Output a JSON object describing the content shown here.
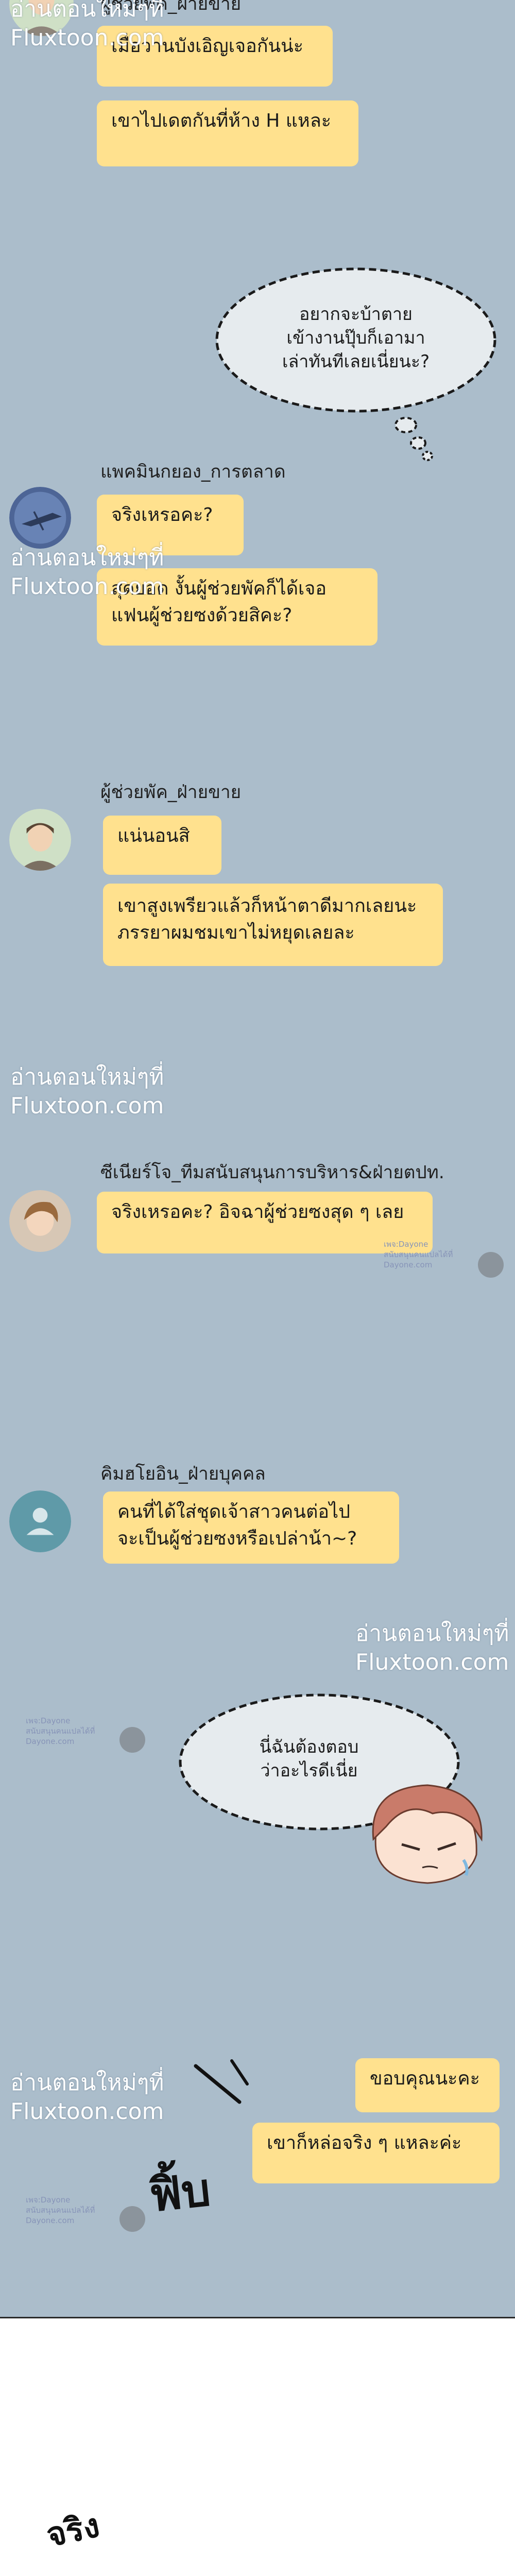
{
  "colors": {
    "chat_background": "#abbdcb",
    "bubble": "#ffe18e",
    "page_background": "#ffffff",
    "divider": "#2a2a2a"
  },
  "messages": [
    {
      "sender": "ผู้ช่วยพัค_ฝ่ายขาย",
      "lines": [
        "เมื่อวานบังเอิญเจอกันน่ะ",
        "เขาไปเดตกันที่ห้าง H แหละ"
      ]
    },
    {
      "sender": "แพคมินกยอง_การตลาด",
      "lines": [
        "จริงเหรอคะ?",
        "สุดยอด งั้นผู้ช่วยพัคก็ได้เจอ",
        "แฟนผู้ช่วยซงด้วยสิคะ?"
      ]
    },
    {
      "sender": "ผู้ช่วยพัค_ฝ่ายขาย",
      "lines": [
        "แน่นอนสิ",
        "เขาสูงเพรียวแล้วก็หน้าตาดีมากเลยนะ",
        "ภรรยาผมชมเขาไม่หยุดเลยละ"
      ]
    },
    {
      "sender": "ซีเนียร์โจ_ทีมสนับสนุนการบริหาร&ฝ่ายตปท.",
      "lines": [
        "จริงเหรอคะ? อิจฉาผู้ช่วยซงสุด ๆ เลย"
      ]
    },
    {
      "sender": "คิมฮโยอิน_ฝ่ายบุคคล",
      "lines": [
        "คนที่ได้ใส่ชุดเจ้าสาวคนต่อไป",
        "จะเป็นผู้ช่วยซงหรือเปล่าน้า~?"
      ]
    },
    {
      "sender": "",
      "lines": [
        "ขอบคุณนะคะ",
        "เขาก็หล่อจริง ๆ แหละค่ะ"
      ]
    }
  ],
  "thoughts": [
    {
      "lines": [
        "อยากจะบ้าตาย",
        "เข้างานปุ๊บก็เอามา",
        "เล่าทันทีเลยเนี่ยนะ?"
      ]
    },
    {
      "lines": [
        "นี่ฉันต้องตอบ",
        "ว่าอะไรดีเนี่ย"
      ]
    }
  ],
  "watermark": {
    "line1": "อ่านตอนใหม่ๆที่",
    "line2": "Fluxtoon.com"
  },
  "credit": {
    "line1": "เพจ:Dayone",
    "line2": "สนับสนุนคนแปลได้ที่",
    "line3": "Dayone.com"
  },
  "sfx": {
    "fip": "ฟิ้บ",
    "jing": "จริง"
  },
  "icons": {
    "default_avatar": "person-silhouette-icon"
  }
}
